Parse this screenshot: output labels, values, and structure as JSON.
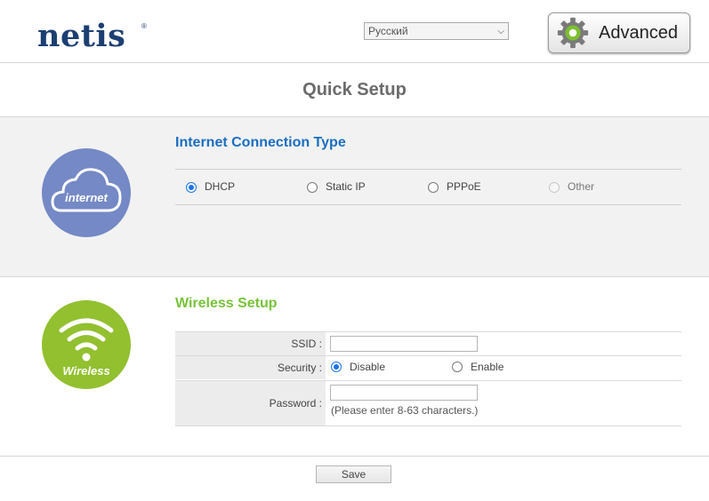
{
  "header": {
    "logo_text": "netis",
    "logo_mark": "®",
    "language": {
      "selected": "Русский"
    },
    "advanced_label": "Advanced"
  },
  "page_title": "Quick Setup",
  "internet": {
    "icon_label": "internet",
    "section_title": "Internet Connection Type",
    "options": [
      {
        "label": "DHCP",
        "selected": true,
        "disabled": false
      },
      {
        "label": "Static IP",
        "selected": false,
        "disabled": false
      },
      {
        "label": "PPPoE",
        "selected": false,
        "disabled": false
      },
      {
        "label": "Other",
        "selected": false,
        "disabled": true
      }
    ]
  },
  "wireless": {
    "icon_label": "Wireless",
    "section_title": "Wireless Setup",
    "ssid_label": "SSID :",
    "ssid_value": "",
    "security_label": "Security :",
    "security_options": [
      {
        "label": "Disable",
        "selected": true
      },
      {
        "label": "Enable",
        "selected": false
      }
    ],
    "password_label": "Password :",
    "password_value": "",
    "password_note": "(Please enter 8-63 characters.)"
  },
  "save_label": "Save",
  "colors": {
    "brand": "#1c3f73",
    "internet_title": "#1b6ec2",
    "wireless_title": "#78c23a",
    "internet_icon_bg": "#7489c5",
    "wireless_icon_bg": "#92c02f"
  }
}
